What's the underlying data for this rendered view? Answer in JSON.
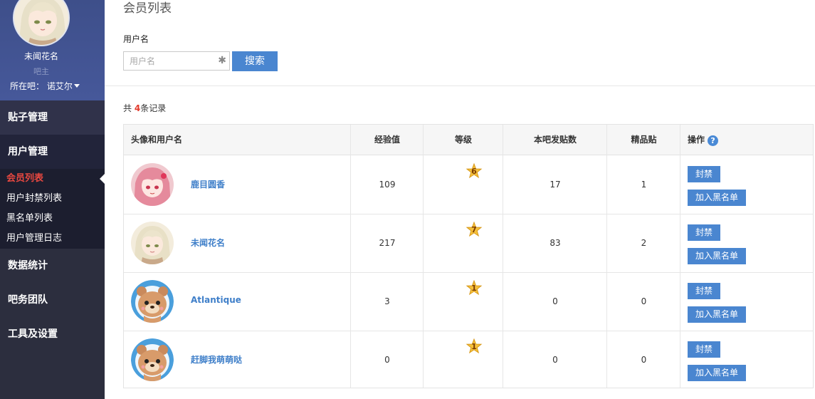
{
  "sidebar": {
    "profile": {
      "name": "未闻花名",
      "role": "吧主",
      "location_label": "所在吧：",
      "location_value": "诺艾尔"
    },
    "menu": {
      "posts": "贴子管理",
      "users": "用户管理",
      "users_sub": [
        "会员列表",
        "用户封禁列表",
        "黑名单列表",
        "用户管理日志"
      ],
      "stats": "数据统计",
      "team": "吧务团队",
      "tools": "工具及设置"
    }
  },
  "main": {
    "title": "会员列表",
    "filter_label": "用户名",
    "search_placeholder": "用户名",
    "search_button": "搜索",
    "count_prefix": "共 ",
    "count_value": "4",
    "count_suffix": "条记录"
  },
  "table": {
    "headers": {
      "user": "头像和用户名",
      "exp": "经验值",
      "level": "等级",
      "posts": "本吧发贴数",
      "featured": "精品贴",
      "ops": "操作"
    },
    "help_symbol": "?",
    "op_ban": "封禁",
    "op_blacklist": "加入黑名单",
    "rows": [
      {
        "name": "鹿目圆香",
        "exp": "109",
        "level": "6",
        "posts": "17",
        "featured": "1"
      },
      {
        "name": "未闻花名",
        "exp": "217",
        "level": "7",
        "posts": "83",
        "featured": "2"
      },
      {
        "name": "Atlantique",
        "exp": "3",
        "level": "1",
        "posts": "0",
        "featured": "0"
      },
      {
        "name": "赶脚我萌萌哒",
        "exp": "0",
        "level": "1",
        "posts": "0",
        "featured": "0"
      }
    ]
  },
  "icons": {
    "clear": "✱"
  },
  "colors": {
    "accent": "#4a86d0",
    "active_menu": "#e94840",
    "sidebar_bg": "#2c2e3e"
  }
}
